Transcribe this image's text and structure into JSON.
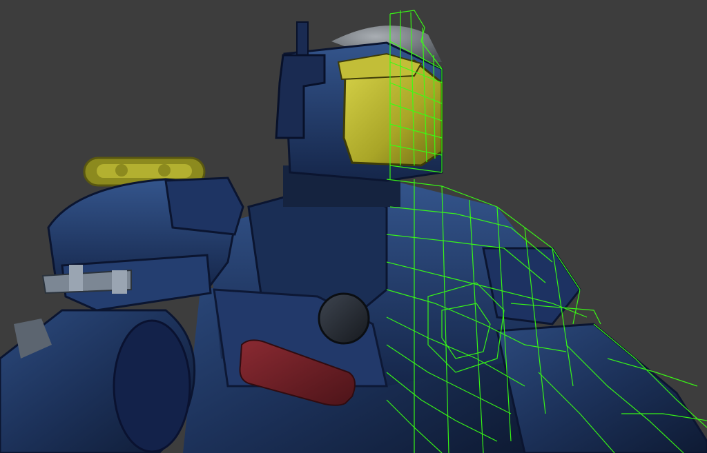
{
  "scene": {
    "subject": "armored-mech-robot",
    "view": "3d-render-half-wireframe",
    "background_color": "#3d3d3d",
    "armor_color": "#1f3560",
    "visor_color": "#b8b42e",
    "accent_red": "#6e1f26",
    "wireframe_color": "#39ff14"
  }
}
